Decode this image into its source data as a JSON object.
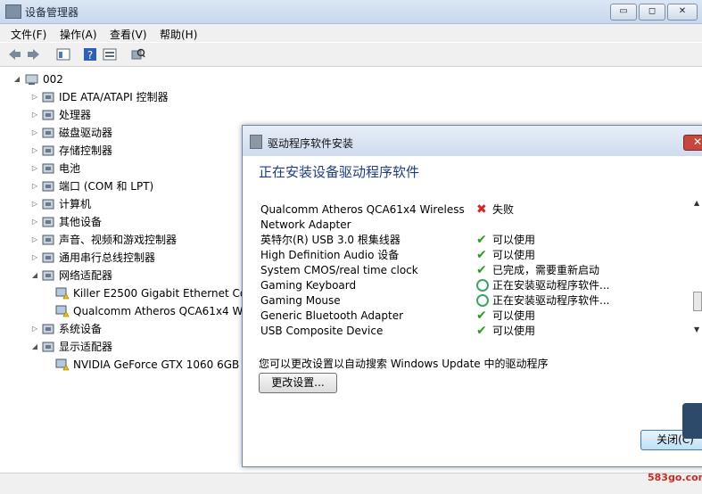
{
  "window": {
    "title": "设备管理器",
    "buttons": {
      "minimize": "▭",
      "maximize": "◻",
      "close": "✕"
    }
  },
  "menu": [
    "文件(F)",
    "操作(A)",
    "查看(V)",
    "帮助(H)"
  ],
  "toolbar": [
    {
      "name": "back-arrow-icon"
    },
    {
      "name": "forward-arrow-icon"
    },
    {
      "name": "properties-icon"
    },
    {
      "name": "help-icon"
    },
    {
      "name": "view-icon"
    },
    {
      "name": "scan-hardware-icon"
    }
  ],
  "tree": {
    "root": "002",
    "items": [
      {
        "label": "IDE ATA/ATAPI 控制器",
        "expander": "▷"
      },
      {
        "label": "处理器",
        "expander": "▷"
      },
      {
        "label": "磁盘驱动器",
        "expander": "▷"
      },
      {
        "label": "存储控制器",
        "expander": "▷"
      },
      {
        "label": "电池",
        "expander": "▷"
      },
      {
        "label": "端口 (COM 和 LPT)",
        "expander": "▷"
      },
      {
        "label": "计算机",
        "expander": "▷"
      },
      {
        "label": "其他设备",
        "expander": "▷"
      },
      {
        "label": "声音、视频和游戏控制器",
        "expander": "▷"
      },
      {
        "label": "通用串行总线控制器",
        "expander": "▷"
      },
      {
        "label": "网络适配器",
        "expander": "◢"
      },
      {
        "label": "Killer E2500 Gigabit Ethernet Co",
        "child": true
      },
      {
        "label": "Qualcomm Atheros QCA61x4 W",
        "child": true
      },
      {
        "label": "系统设备",
        "expander": "▷"
      },
      {
        "label": "显示适配器",
        "expander": "◢"
      },
      {
        "label": "NVIDIA GeForce GTX 1060 6GB",
        "child": true
      }
    ]
  },
  "dialog": {
    "title": "驱动程序软件安装",
    "close": "✕",
    "heading": "正在安装设备驱动程序软件",
    "devices": [
      {
        "name": "Qualcomm Atheros QCA61x4 Wireless",
        "status": "失败",
        "kind": "fail"
      },
      {
        "name": "Network Adapter",
        "status": "",
        "kind": "none"
      },
      {
        "name": "英特尔(R) USB 3.0 根集线器",
        "status": "可以使用",
        "kind": "ok"
      },
      {
        "name": "High Definition Audio 设备",
        "status": "可以使用",
        "kind": "ok"
      },
      {
        "name": "System CMOS/real time clock",
        "status": "已完成，需要重新启动",
        "kind": "ok"
      },
      {
        "name": "Gaming Keyboard",
        "status": "正在安装驱动程序软件...",
        "kind": "spin"
      },
      {
        "name": "Gaming Mouse",
        "status": "正在安装驱动程序软件...",
        "kind": "spin"
      },
      {
        "name": "Generic Bluetooth Adapter",
        "status": "可以使用",
        "kind": "ok"
      },
      {
        "name": "USB Composite Device",
        "status": "可以使用",
        "kind": "ok"
      }
    ],
    "hint": "您可以更改设置以自动搜索 Windows Update 中的驱动程序",
    "change_button": "更改设置...",
    "close_button": "关闭(C)"
  },
  "watermark": "583go.com",
  "colors": {
    "heading": "#1e3b8a",
    "ok": "#2e9a26",
    "fail": "#d7261e"
  }
}
